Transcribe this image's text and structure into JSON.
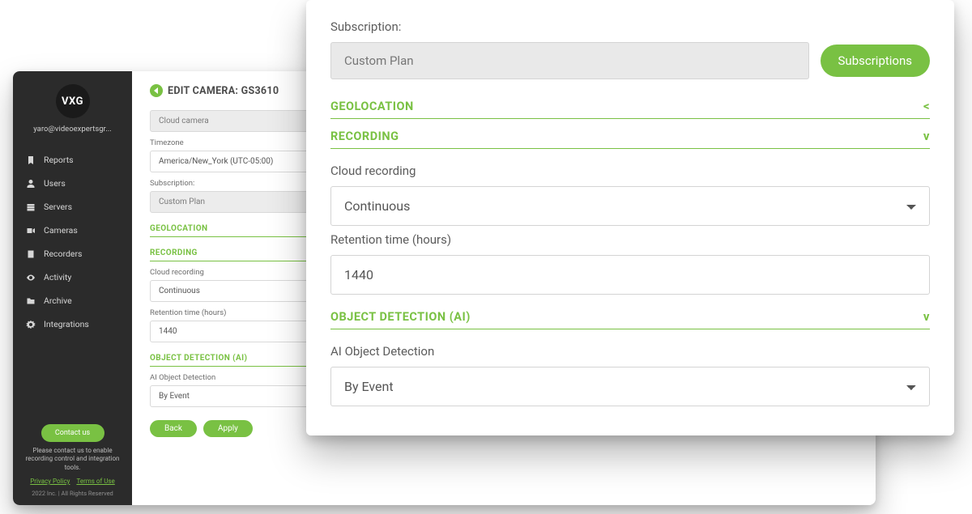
{
  "brand": {
    "logo_text": "VXG"
  },
  "user": {
    "email_truncated": "yaro@videoexpertsgr..."
  },
  "sidebar": {
    "items": [
      {
        "label": "Reports",
        "icon": "bookmark-icon"
      },
      {
        "label": "Users",
        "icon": "user-icon"
      },
      {
        "label": "Servers",
        "icon": "server-icon"
      },
      {
        "label": "Cameras",
        "icon": "camera-icon"
      },
      {
        "label": "Recorders",
        "icon": "recorder-icon"
      },
      {
        "label": "Activity",
        "icon": "eye-icon"
      },
      {
        "label": "Archive",
        "icon": "folder-icon"
      },
      {
        "label": "Integrations",
        "icon": "gears-icon"
      }
    ],
    "contact_label": "Contact us",
    "note_text": "Please contact us to enable recording control and integration tools.",
    "privacy_label": "Privacy Policy",
    "terms_label": "Terms of Use",
    "copyright": "2022 Inc. | All Rights Reserved"
  },
  "main": {
    "title": "EDIT CAMERA: GS3610",
    "camera_type": "Cloud camera",
    "timezone_label": "Timezone",
    "timezone_value": "America/New_York (UTC-05:00)",
    "subscription_label": "Subscription:",
    "subscription_value": "Custom Plan",
    "sections": {
      "geo": "GEOLOCATION",
      "rec": "RECORDING",
      "ai": "OBJECT DETECTION (AI)"
    },
    "cloud_rec_label": "Cloud recording",
    "cloud_rec_value": "Continuous",
    "retention_label": "Retention time (hours)",
    "retention_value": "1440",
    "ai_label": "AI Object Detection",
    "ai_value": "By Event",
    "back_btn": "Back",
    "apply_btn": "Apply"
  },
  "overlay": {
    "subscription_label": "Subscription:",
    "subscription_value": "Custom Plan",
    "subscriptions_btn": "Subscriptions",
    "sections": {
      "geo": {
        "title": "GEOLOCATION",
        "toggle": "<"
      },
      "rec": {
        "title": "RECORDING",
        "toggle": "v"
      },
      "ai": {
        "title": "OBJECT DETECTION (AI)",
        "toggle": "v"
      }
    },
    "cloud_rec_label": "Cloud recording",
    "cloud_rec_value": "Continuous",
    "retention_label": "Retention time (hours)",
    "retention_value": "1440",
    "ai_label": "AI Object Detection",
    "ai_value": "By Event"
  }
}
